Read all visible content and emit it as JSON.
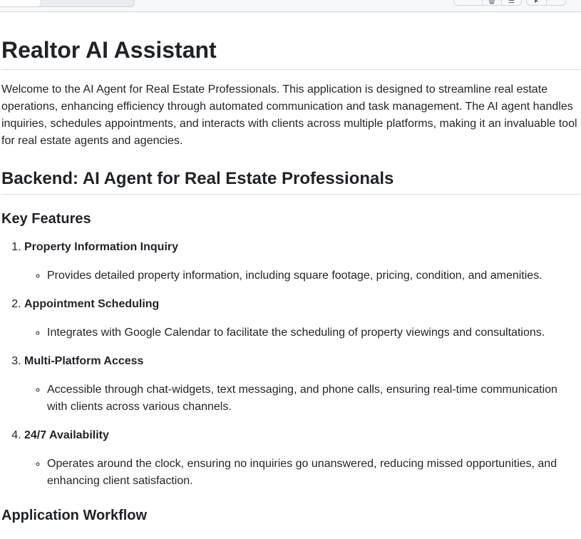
{
  "toolbar": {
    "buttons": [
      {
        "label": ""
      },
      {
        "label": "🗑"
      },
      {
        "label": "☰"
      },
      {
        "label": "▸"
      },
      {
        "label": ""
      }
    ]
  },
  "page": {
    "title": "Realtor AI Assistant",
    "intro": "Welcome to the AI Agent for Real Estate Professionals. This application is designed to streamline real estate operations, enhancing efficiency through automated communication and task management. The AI agent handles inquiries, schedules appointments, and interacts with clients across multiple platforms, making it an invaluable tool for real estate agents and agencies.",
    "backend_heading": "Backend: AI Agent for Real Estate Professionals",
    "key_features_heading": "Key Features",
    "features": [
      {
        "title": "Property Information Inquiry",
        "detail": "Provides detailed property information, including square footage, pricing, condition, and amenities."
      },
      {
        "title": "Appointment Scheduling",
        "detail": "Integrates with Google Calendar to facilitate the scheduling of property viewings and consultations."
      },
      {
        "title": "Multi-Platform Access",
        "detail": "Accessible through chat-widgets, text messaging, and phone calls, ensuring real-time communication with clients across various channels."
      },
      {
        "title": "24/7 Availability",
        "detail": "Operates around the clock, ensuring no inquiries go unanswered, reducing missed opportunities, and enhancing client satisfaction."
      }
    ],
    "workflow_heading": "Application Workflow"
  }
}
